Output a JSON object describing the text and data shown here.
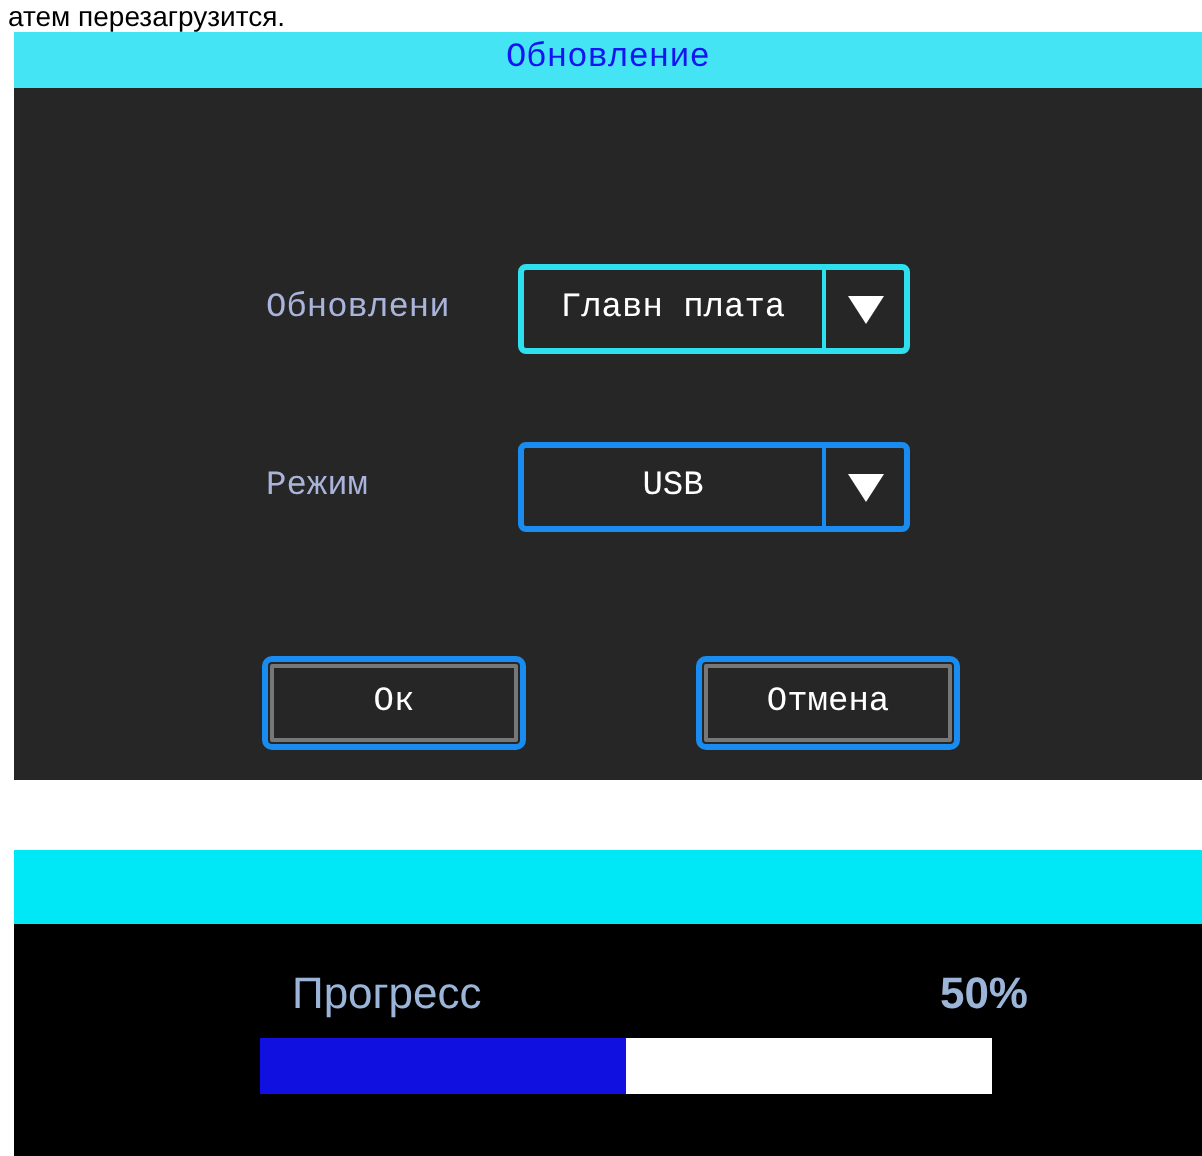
{
  "caption": "атем перезагрузится.",
  "update_dialog": {
    "title": "Обновление",
    "fields": [
      {
        "label": "Обновлени",
        "value": "Главн плата",
        "focused": true
      },
      {
        "label": "Режим",
        "value": "USB",
        "focused": false
      }
    ],
    "buttons": [
      "Ок",
      "Отмена"
    ]
  },
  "progress_dialog": {
    "label": "Прогресс",
    "reading": "50%",
    "level": 0.5
  }
}
